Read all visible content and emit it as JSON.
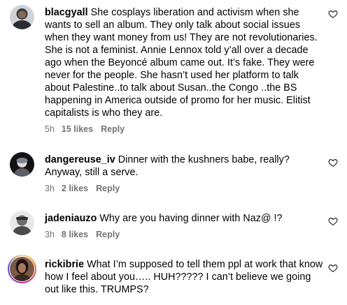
{
  "comments": [
    {
      "username": "blacgyall",
      "text": "She cosplays liberation and activism when she wants to sell an album. They only talk about social issues when they want money from us! They are not revolutionaries. She is not a feminist. Annie Lennox told y’all over a decade ago when the Beyoncé album came out. It’s fake. They were never for the people. She hasn’t used her platform to talk about Palestine..to talk about Susan..the Congo ..the BS happening in America outside of promo for her music. Elitist capitalists is who they are.",
      "time": "5h",
      "likes": "15 likes",
      "reply": "Reply"
    },
    {
      "username": "dangereuse_iv",
      "text": "Dinner with the kushners babe, really? Anyway, still a serve.",
      "time": "3h",
      "likes": "2 likes",
      "reply": "Reply"
    },
    {
      "username": "jadeniauzo",
      "text": "Why are you having dinner with Naz@ !?",
      "time": "3h",
      "likes": "8 likes",
      "reply": "Reply"
    },
    {
      "username": "rickibrie",
      "text": "What I’m supposed to tell them ppl at work that know how I feel about you….. HUH????? I can’t believe we going out like this. TRUMPS?",
      "time": "",
      "likes": "",
      "reply": ""
    }
  ],
  "icons": {
    "like": "heart-outline-icon"
  },
  "colors": {
    "meta_text": "#737373",
    "text": "#000000",
    "story_ring": [
      "#feda75",
      "#fa7e1e",
      "#d62976",
      "#962fbf",
      "#4f5bd5"
    ]
  }
}
